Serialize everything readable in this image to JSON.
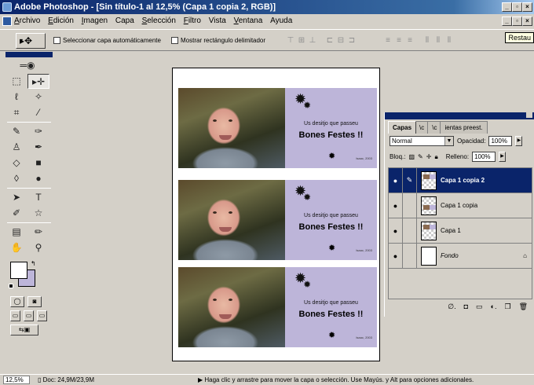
{
  "window": {
    "title": "Adobe Photoshop - [Sin título-1 al 12,5% (Capa 1 copia 2, RGB)]"
  },
  "menu": {
    "items": [
      {
        "first": "A",
        "rest": "rchivo"
      },
      {
        "first": "E",
        "rest": "dición"
      },
      {
        "first": "I",
        "rest": "magen"
      },
      {
        "first": "",
        "rest": "Capa"
      },
      {
        "first": "S",
        "rest": "elección"
      },
      {
        "first": "F",
        "rest": "iltro"
      },
      {
        "first": "",
        "rest": "Vista"
      },
      {
        "first": "V",
        "rest": "entana"
      },
      {
        "first": "",
        "rest": "Ayuda"
      }
    ]
  },
  "options": {
    "auto_select_label": "Seleccionar capa automáticamente",
    "show_bounds_label": "Mostrar rectángulo delimitador",
    "restore_label": "Restau"
  },
  "cards": [
    {
      "message": "Us desitjo que passeu",
      "greeting": "Bones Festes !!",
      "signature": "Isaac, 2003"
    },
    {
      "message": "Us desitjo que passeu",
      "greeting": "Bones Festes !!",
      "signature": "Isaac, 2003"
    },
    {
      "message": "Us desitjo que passeu",
      "greeting": "Bones Festes !!",
      "signature": "Isaac, 2003"
    }
  ],
  "colors": {
    "foreground": "#ffffff",
    "background": "#bdb5d9",
    "card_panel": "#bdb5d9",
    "selection": "#0a246a"
  },
  "layers_panel": {
    "tabs": [
      "Capas",
      "\\c",
      "\\c",
      "ientas preest."
    ],
    "blend_mode": "Normal",
    "opacity_label": "Opacidad:",
    "opacity_value": "100%",
    "lock_label": "Bloq.:",
    "fill_label": "Relleno:",
    "fill_value": "100%",
    "layers": [
      {
        "name": "Capa 1 copia 2",
        "selected": true
      },
      {
        "name": "Capa 1 copia",
        "selected": false
      },
      {
        "name": "Capa 1",
        "selected": false
      },
      {
        "name": "Fondo",
        "selected": false
      }
    ]
  },
  "status": {
    "zoom": "12,5%",
    "doc_info": "Doc: 24,9M/23,9M",
    "hint": "Haga clic y arrastre para mover la capa o selección. Use Mayús. y Alt para opciones adicionales."
  }
}
